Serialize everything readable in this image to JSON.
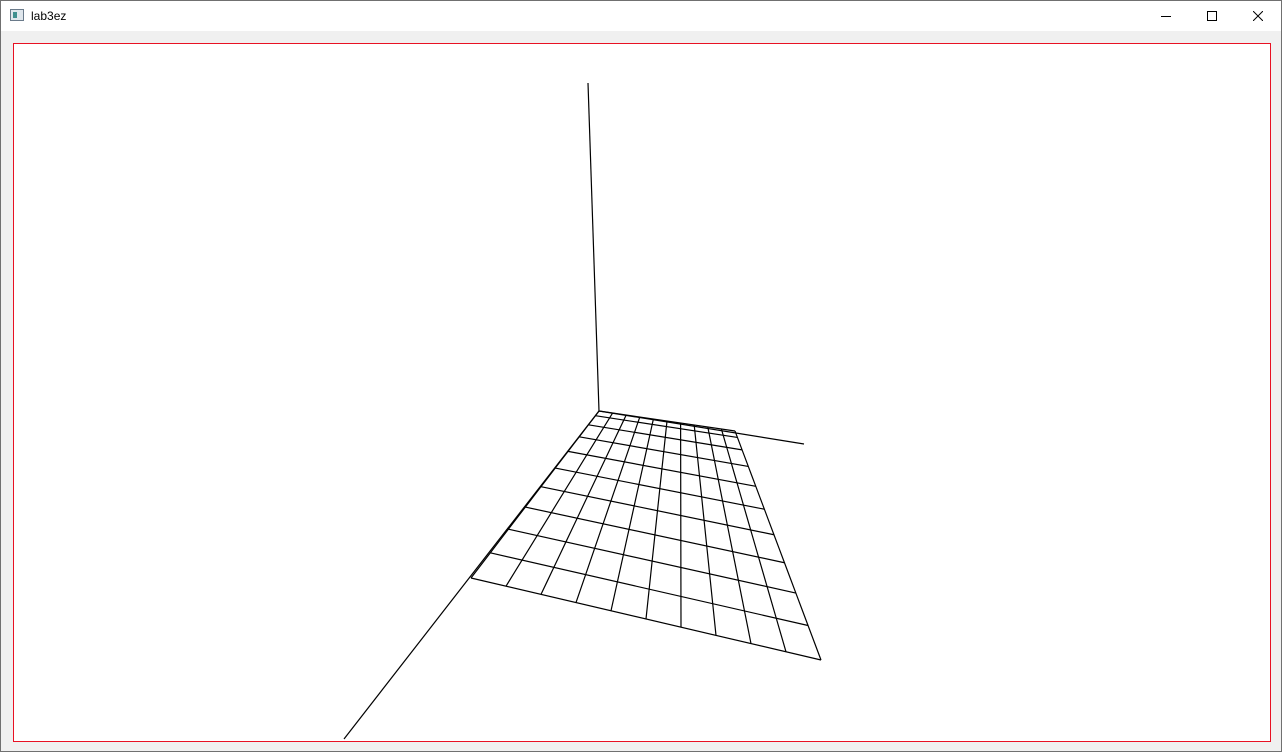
{
  "window": {
    "title": "lab3ez",
    "app_icon": "app-icon",
    "controls": {
      "minimize_icon": "minimize-icon",
      "maximize_icon": "maximize-icon",
      "close_icon": "close-icon"
    }
  },
  "colors": {
    "canvas_border": "#e81123",
    "canvas_background": "#ffffff",
    "line": "#000000"
  },
  "scene": {
    "grid_columns": 10,
    "grid_rows": 10
  }
}
